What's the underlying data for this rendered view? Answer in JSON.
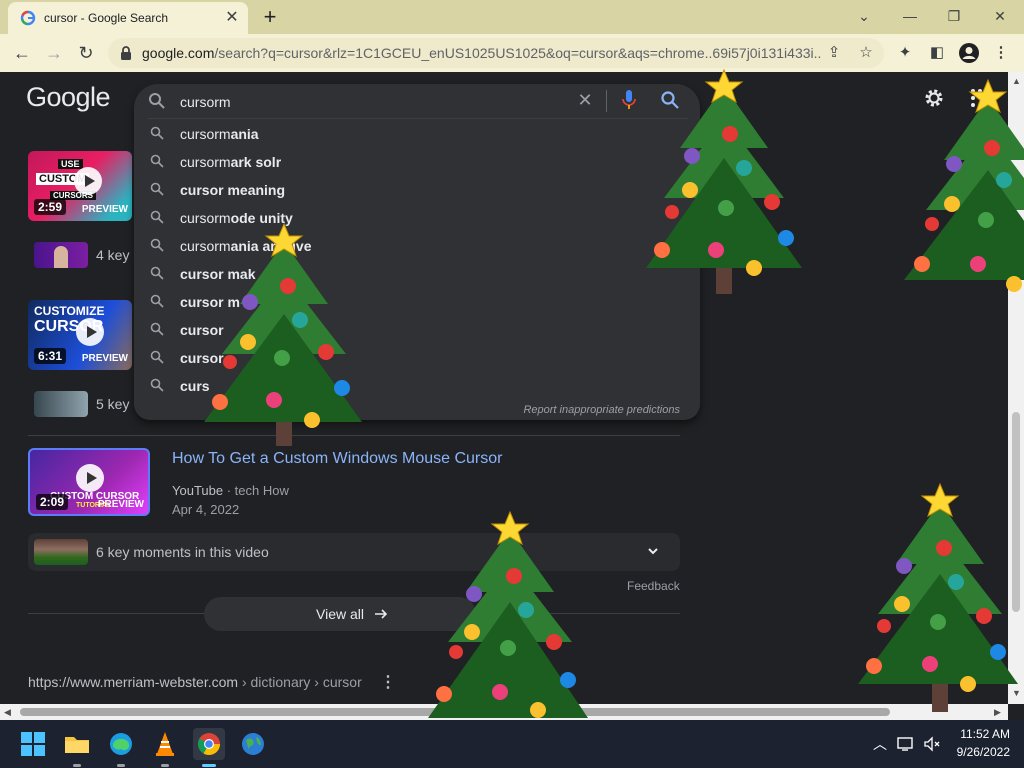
{
  "browser": {
    "tab_title": "cursor - Google Search",
    "url_host": "google.com",
    "url_rest": "/search?q=cursor&rlz=1C1GCEU_enUS1025US1025&oq=cursor&aqs=chrome..69i57j0i131i433i..."
  },
  "search": {
    "query": "cursorm",
    "suggestions": [
      {
        "typed": "cursorm",
        "completion": "ania"
      },
      {
        "typed": "cursorm",
        "completion": "ark solr"
      },
      {
        "typed": "",
        "completion": "cursor meaning"
      },
      {
        "typed": "cursorm",
        "completion": "ode unity"
      },
      {
        "typed": "cursorm",
        "completion": "ania archive"
      },
      {
        "typed": "",
        "completion": "cursor mak"
      },
      {
        "typed": "",
        "completion": "cursor m"
      },
      {
        "typed": "",
        "completion": "cursor"
      },
      {
        "typed": "",
        "completion": "cursor"
      },
      {
        "typed": "",
        "completion": "curs"
      }
    ],
    "report_text": "Report inappropriate predictions"
  },
  "logo": "Google",
  "results": {
    "video1": {
      "duration": "2:59",
      "preview": "PREVIEW",
      "thumb_top": "USE",
      "thumb_mid": "CUSTOM",
      "thumb_bottom": "CURSORS"
    },
    "km1": "4 key",
    "video2": {
      "duration": "6:31",
      "preview": "PREVIEW",
      "thumb_text1": "CUSTOMIZE",
      "thumb_text2": "CURSOR"
    },
    "km2": "5 key",
    "video3": {
      "duration": "2:09",
      "preview": "PREVIEW",
      "thumb_text": "CUSTOM CURSOR",
      "thumb_sub": "TUTORIAL"
    },
    "title": "How To Get a Custom Windows Mouse Cursor",
    "source": "YouTube",
    "channel": "tech How",
    "date": "Apr 4, 2022",
    "km3": "6 key moments in this video",
    "feedback": "Feedback",
    "view_all": "View all",
    "cite_host": "https://www.merriam-webster.com",
    "cite_path": " › dictionary › cursor"
  },
  "taskbar": {
    "time": "11:52 AM",
    "date": "9/26/2022"
  },
  "colors": {
    "link": "#8ab4f8",
    "page_bg": "#202124",
    "tab_bar": "#d9d4a4"
  }
}
